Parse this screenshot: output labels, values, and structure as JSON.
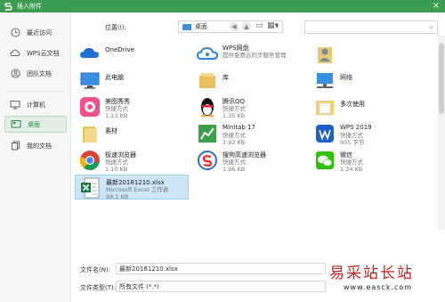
{
  "window": {
    "title": "插入附件",
    "close_glyph": "×",
    "accent_color": "#3b9c52"
  },
  "sidebar": {
    "items": [
      {
        "label": "最近访问",
        "icon": "clock-icon"
      },
      {
        "label": "WPS云文档",
        "icon": "cloud-icon"
      },
      {
        "label": "团队文档",
        "icon": "team-icon"
      },
      {
        "label": "计算机",
        "icon": "monitor-icon"
      },
      {
        "label": "桌面",
        "icon": "desktop-icon",
        "active": true
      },
      {
        "label": "我的文档",
        "icon": "documents-icon"
      }
    ]
  },
  "toolbar": {
    "location_label": "位置(I):",
    "location_value": "桌面"
  },
  "files": [
    {
      "name": "OneDrive",
      "type": "",
      "size": ""
    },
    {
      "name": "WPS网盘",
      "type": "提供免费云同步服务管理",
      "size": ""
    },
    {
      "name": "",
      "type": "",
      "size": ""
    },
    {
      "name": "此电脑",
      "type": "",
      "size": ""
    },
    {
      "name": "库",
      "type": "",
      "size": ""
    },
    {
      "name": "网络",
      "type": "",
      "size": ""
    },
    {
      "name": "美图秀秀",
      "type": "快捷方式",
      "size": "1.13 KB"
    },
    {
      "name": "腾讯QQ",
      "type": "快捷方式",
      "size": "1.35 KB"
    },
    {
      "name": "多次使用",
      "type": "",
      "size": ""
    },
    {
      "name": "素材",
      "type": "",
      "size": ""
    },
    {
      "name": "Minitab 17",
      "type": "快捷方式",
      "size": "1.92 KB"
    },
    {
      "name": "WPS 2019",
      "type": "快捷方式",
      "size": "905 字节"
    },
    {
      "name": "极速浏览器",
      "type": "快捷方式",
      "size": "1.10 KB"
    },
    {
      "name": "搜狗高速浏览器",
      "type": "快捷方式",
      "size": "1.96 KB"
    },
    {
      "name": "微信",
      "type": "快捷方式",
      "size": "1.24 KB"
    },
    {
      "name": "最新20181210.xlsx",
      "type": "Microsoft Excel 工作表",
      "size": "98.1 KB",
      "selected": true
    }
  ],
  "bottom": {
    "filename_label": "文件名(N):",
    "filename_value": "最新20181210.xlsx",
    "filetype_label": "文件类型(T):",
    "filetype_value": "所有文件 (*.*)"
  },
  "watermark": {
    "logo_text": "易采站长站",
    "url": "www.easck.com"
  }
}
